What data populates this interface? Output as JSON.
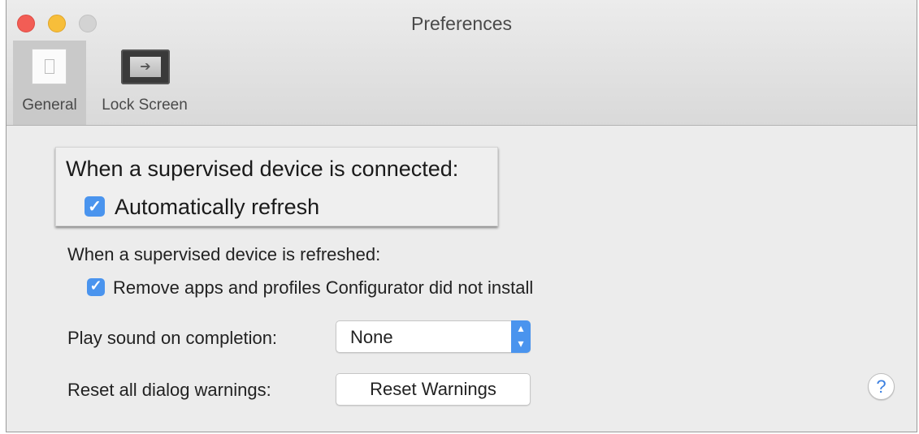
{
  "window": {
    "title": "Preferences"
  },
  "toolbar": {
    "tabs": [
      {
        "label": "General",
        "icon": "general-icon",
        "selected": true
      },
      {
        "label": "Lock Screen",
        "icon": "lock-screen-icon",
        "selected": false
      }
    ]
  },
  "general": {
    "connected_heading": "When a supervised device is connected:",
    "auto_refresh": {
      "label": "Automatically refresh",
      "checked": true
    },
    "refreshed_heading": "When a supervised device is refreshed:",
    "remove_apps": {
      "label": "Remove apps and profiles Configurator did not install",
      "checked": true
    },
    "sound_label": "Play sound on completion:",
    "sound_value": "None",
    "reset_label": "Reset all dialog warnings:",
    "reset_button": "Reset Warnings",
    "help": "?"
  },
  "colors": {
    "accent": "#4a94ee",
    "close": "#f25d55",
    "minimize": "#f7be3a",
    "zoom_disabled": "#d3d3d3"
  }
}
